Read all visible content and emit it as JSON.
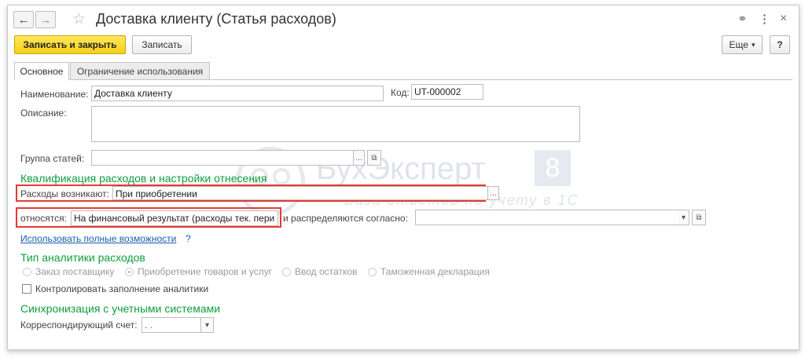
{
  "window": {
    "title": "Доставка клиенту (Статья расходов)",
    "back_icon": "←",
    "forward_icon": "→",
    "star_icon": "☆",
    "link_icon": "⚭",
    "menu_icon": "⋮",
    "close_icon": "×"
  },
  "toolbar": {
    "save_close_label": "Записать и закрыть",
    "save_label": "Записать",
    "more_label": "Еще",
    "more_arrow": "▾",
    "help_label": "?"
  },
  "tabs": [
    {
      "label": "Основное",
      "active": true
    },
    {
      "label": "Ограничение использования",
      "active": false
    }
  ],
  "form": {
    "name_label": "Наименование:",
    "name_value": "Доставка клиенту",
    "code_label": "Код:",
    "code_value": "UT-000002",
    "description_label": "Описание:",
    "description_value": "",
    "group_label": "Группа статей:",
    "group_value": "",
    "dots": "...",
    "open_icon": "⧉"
  },
  "qualification": {
    "title": "Квалификация расходов и настройки отнесения",
    "arise_label": "Расходы возникают:",
    "arise_value": "При приобретении",
    "relate_label": "относятся:",
    "relate_value": "На финансовый результат (расходы тек. пери",
    "distribute_label": "и распределяются согласно:",
    "distribute_value": "",
    "link_label": "Использовать полные возможности",
    "help_mark": "?"
  },
  "analytics": {
    "title": "Тип аналитики расходов",
    "options": [
      {
        "label": "Заказ поставщику",
        "selected": false
      },
      {
        "label": "Приобретение товаров и услуг",
        "selected": true
      },
      {
        "label": "Ввод остатков",
        "selected": false
      },
      {
        "label": "Таможенная декларация",
        "selected": false
      }
    ],
    "control_label": "Контролировать заполнение аналитики",
    "control_checked": false
  },
  "sync": {
    "title": "Синхронизация с учетными системами",
    "account_label": "Корреспондирующий счет:",
    "account_value": ".   .",
    "dropdown_arrow": "▾"
  },
  "watermark": {
    "brand": "БухЭксперт",
    "number": "8",
    "tagline": "База ответов по учету в 1С"
  },
  "colors": {
    "section_green": "#0f9d3c",
    "link_blue": "#1a5cb0",
    "primary_yellow": "#f5cf19",
    "highlight_red": "#e53935"
  }
}
